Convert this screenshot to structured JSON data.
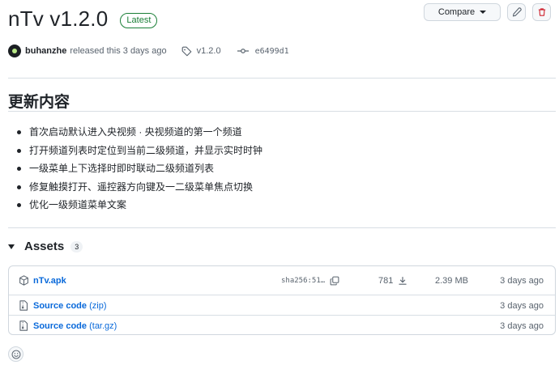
{
  "release": {
    "title": "nTv v1.2.0",
    "badge": "Latest",
    "compare_label": "Compare",
    "author": "buhanzhe",
    "released_text": "released this 3 days ago",
    "tag": "v1.2.0",
    "commit": "e6499d1"
  },
  "notes": {
    "heading": "更新内容",
    "items": [
      "首次启动默认进入央视频 · 央视频道的第一个频道",
      "打开频道列表时定位到当前二级频道，并显示实时时钟",
      "一级菜单上下选择时即时联动二级频道列表",
      "修复触摸打开、遥控器方向键及一二级菜单焦点切换",
      "优化一级频道菜单文案"
    ]
  },
  "assets": {
    "title": "Assets",
    "count": "3",
    "files": [
      {
        "name": "nTv.apk",
        "suffix": "",
        "sha": "sha256:51…",
        "downloads": "781",
        "size": "2.39 MB",
        "date": "3 days ago"
      },
      {
        "name": "Source code",
        "suffix": "(zip)",
        "date": "3 days ago"
      },
      {
        "name": "Source code",
        "suffix": "(tar.gz)",
        "date": "3 days ago"
      }
    ]
  },
  "icons": {
    "tag": "tag-icon",
    "commit": "git-commit-icon",
    "edit": "pencil-icon",
    "delete": "trash-icon",
    "package": "package-icon",
    "zip": "file-zip-icon",
    "copy": "copy-icon",
    "download": "download-icon",
    "reaction": "smiley-icon"
  },
  "colors": {
    "link": "#0969da",
    "latest": "#1a7f37",
    "danger": "#cf222e"
  }
}
